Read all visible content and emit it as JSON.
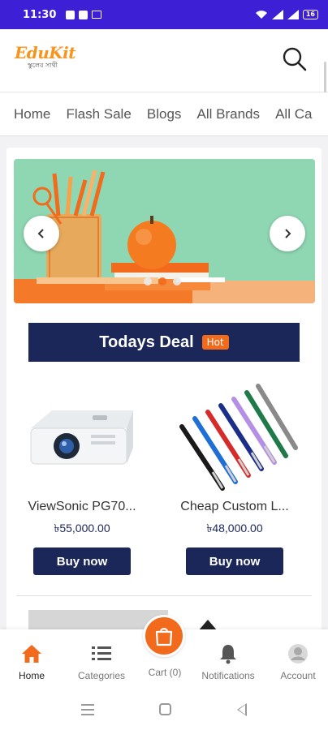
{
  "status_bar": {
    "time": "11:30",
    "battery": "16",
    "icons": [
      "facebook-icon",
      "linkedin-icon",
      "mail-icon",
      "wifi-icon",
      "signal-icon",
      "signal-icon",
      "battery-icon"
    ]
  },
  "header": {
    "logo_text": "EduKit",
    "logo_tagline": "স্কুলের সাথী",
    "search_icon": "search-icon"
  },
  "category_nav": {
    "items": [
      "Home",
      "Flash Sale",
      "Blogs",
      "All Brands",
      "All Ca"
    ]
  },
  "banner": {
    "prev_icon": "chevron-left-icon",
    "next_icon": "chevron-right-icon",
    "slide_count": 3,
    "active_slide": 2
  },
  "todays_deal": {
    "title": "Todays Deal",
    "badge": "Hot"
  },
  "products": [
    {
      "name": "ViewSonic PG70...",
      "price": "৳55,000.00",
      "button": "Buy now"
    },
    {
      "name": "Cheap Custom L...",
      "price": "৳48,000.00",
      "button": "Buy now"
    }
  ],
  "bottom_nav": {
    "home": "Home",
    "categories": "Categories",
    "cart": "Cart (0)",
    "notifications": "Notifications",
    "account": "Account"
  },
  "colors": {
    "status_bar": "#3d1fd6",
    "brand_orange": "#f26b1d",
    "navy": "#1b2659"
  }
}
